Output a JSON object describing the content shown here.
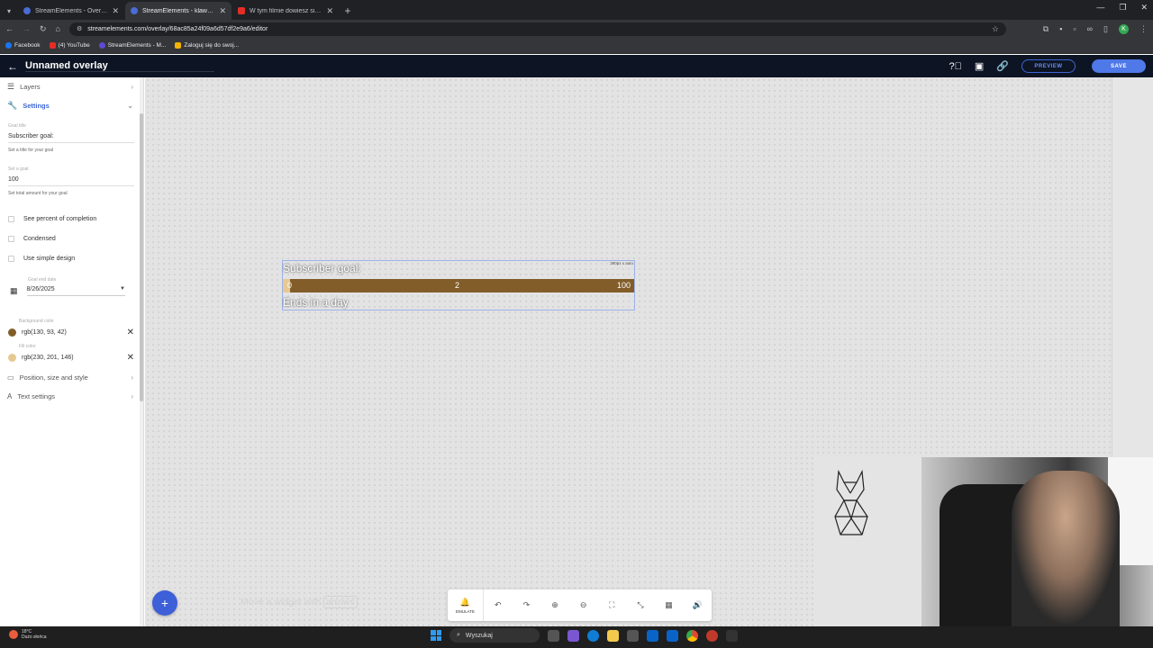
{
  "browser": {
    "tabs": [
      {
        "title": "StreamElements - Overlays",
        "icon": "streamelements-icon",
        "active": false
      },
      {
        "title": "StreamElements - klawdiaa",
        "icon": "streamelements-icon",
        "active": true
      },
      {
        "title": "W tym filmie dowiesz się jak u...",
        "icon": "youtube-icon",
        "active": false
      }
    ],
    "url": "streamelements.com/overlay/68ac85a24f09a6d57df2e9a6/editor",
    "profile_initial": "K",
    "bookmarks": [
      {
        "label": "Facebook",
        "icon": "facebook-icon"
      },
      {
        "label": "(4) YouTube",
        "icon": "youtube-icon"
      },
      {
        "label": "StreamElements - M...",
        "icon": "streamelements-icon"
      },
      {
        "label": "Zaloguj się do swoj...",
        "icon": "bookmark-icon"
      }
    ]
  },
  "header": {
    "overlay_name": "Unnamed overlay",
    "preview_label": "PREVIEW",
    "save_label": "SAVE"
  },
  "sidebar": {
    "layers_label": "Layers",
    "settings_label": "Settings",
    "goal_title_label": "Goal title",
    "goal_title_value": "Subscriber goal:",
    "goal_title_hint": "Set a title for your goal",
    "goal_label": "Set a goal",
    "goal_value": "100",
    "goal_hint": "Set total amount for your goal",
    "check_percent": "See percent of completion",
    "check_condensed": "Condensed",
    "check_simple": "Use simple design",
    "end_date_label": "Goal end date",
    "end_date_value": "8/26/2025",
    "bg_color_label": "Background color",
    "bg_color_value": "rgb(130, 93, 42)",
    "fill_color_label": "Fill color",
    "fill_color_value": "rgb(230, 201, 146)",
    "position_label": "Position, size and style",
    "text_settings_label": "Text settings"
  },
  "widget": {
    "size_label": "390px x auto",
    "title": "Subscriber goal:",
    "min": "0",
    "current": "2",
    "max": "100",
    "progress": 0.02,
    "ends_text": "Ends in a day",
    "bg_color": "#825d2a",
    "fill_color": "#e6c992"
  },
  "canvas": {
    "move_hint_prefix": "Move a widget with",
    "move_hint_key": "arrows"
  },
  "bottom_toolbar": {
    "emulate_label": "EMULATE"
  },
  "taskbar": {
    "temperature": "18°C",
    "weather_text": "Dużo słońca",
    "search_placeholder": "Wyszukaj"
  }
}
